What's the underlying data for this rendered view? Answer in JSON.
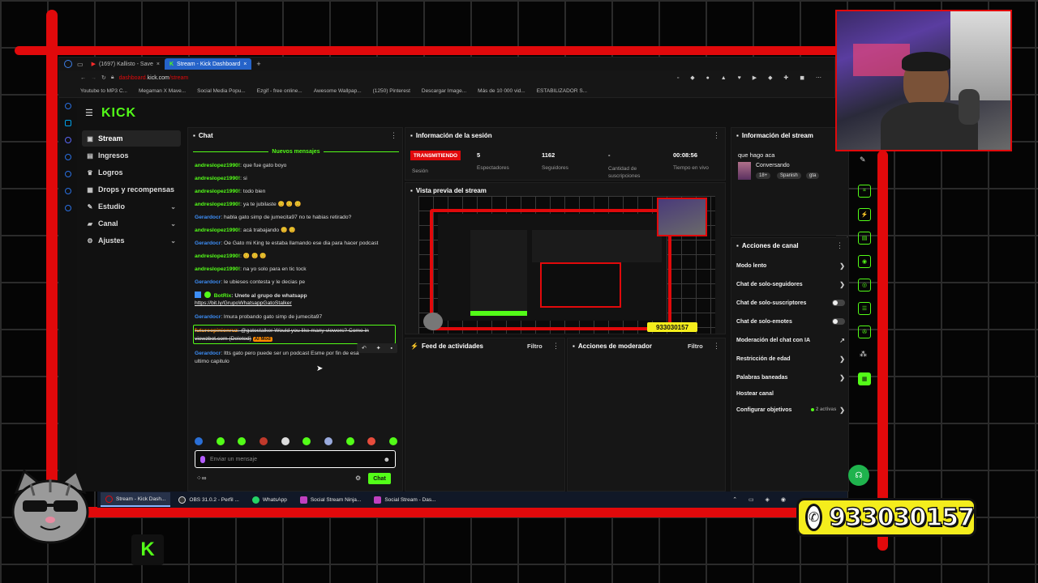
{
  "browser": {
    "tabs": [
      {
        "label": "(1697) Kallisto - Save"
      },
      {
        "label": "Stream - Kick Dashboard"
      }
    ],
    "url_sub": "dashboard.",
    "url_host": "kick.com",
    "url_path": "/stream",
    "bookmarks": [
      "Youtube to MP3 C...",
      "Megaman X Mave...",
      "Social Media Popu...",
      "Ezgif - free online...",
      "Awesome Wallpap...",
      "(1250) Pinterest",
      "Descargar Image...",
      "Más de 10 000 vid...",
      "ESTABILIZADOR S..."
    ]
  },
  "sidebar": {
    "logo": "KICK",
    "items": [
      {
        "label": "Stream",
        "icon": "stream-icon"
      },
      {
        "label": "Ingresos",
        "icon": "revenue-icon"
      },
      {
        "label": "Logros",
        "icon": "trophy-icon"
      },
      {
        "label": "Drops y recompensas",
        "icon": "gift-icon"
      },
      {
        "label": "Estudio",
        "icon": "studio-icon"
      },
      {
        "label": "Canal",
        "icon": "channel-icon"
      },
      {
        "label": "Ajustes",
        "icon": "gear-icon"
      }
    ]
  },
  "chat": {
    "title": "Chat",
    "new_messages": "Nuevos mensajes",
    "messages": [
      {
        "user": "andreslopez1990!",
        "text": ": que fue gato boyo"
      },
      {
        "user": "andreslopez1990!",
        "text": ": si"
      },
      {
        "user": "andreslopez1990!",
        "text": ": todo bien"
      },
      {
        "user": "andreslopez1990!",
        "text": ": ya te jubilaste 😊 😊 😊"
      },
      {
        "user": "Gerardocr",
        "text": ": habla gato simp de jumecita97 no te habias retirado?"
      },
      {
        "user": "andreslopez1990!",
        "text": ": acá trabajando 😊 😊"
      },
      {
        "user": "Gerardocr",
        "text": ": Oe Gato mi King te estaba llamando ese dia para hacer podcast"
      },
      {
        "user": "andreslopez1990!",
        "text": ": 😊 😊 😊"
      },
      {
        "user": "andreslopez1990!",
        "text": ": na yo solo para en tic tock"
      },
      {
        "user": "Gerardocr",
        "text": ": le ubieses contesta y le decias pe"
      },
      {
        "user": "BotRix",
        "text": ": Unete al grupo de whatsapp"
      },
      {
        "user": "",
        "text": "https://bit.ly/GrupoWhatsappGatoStalker"
      },
      {
        "user": "Gerardocr",
        "text": ": lmura probando gato simp de jumecita97"
      },
      {
        "user": "futureopinionruz",
        "text": ": @gatostalker Would you like many viewers? Come in"
      },
      {
        "user": "",
        "text": "viewzbot.com (Deleted)"
      },
      {
        "user": "Gerardocr",
        "text": ": Itts gato pero puede ser un podcast Esme por fin de esa"
      },
      {
        "user": "",
        "text": "ultimo capitulo"
      }
    ],
    "mod_badge": "AI Mod",
    "input_placeholder": "Enviar un mensaje",
    "send_label": "Chat"
  },
  "session": {
    "title": "Información de la sesión",
    "live_badge": "TRANSMITIENDO",
    "session_label": "Sesión",
    "stats": [
      {
        "value": "5",
        "label": "Espectadores"
      },
      {
        "value": "1162",
        "label": "Seguidores"
      },
      {
        "value": "-",
        "label": "Cantidad de suscripciones"
      },
      {
        "value": "00:08:56",
        "label": "Tiempo en vivo"
      }
    ]
  },
  "preview": {
    "title": "Vista previa del stream",
    "phone_overlay": "933030157"
  },
  "activity": {
    "title": "Feed de actividades",
    "filter": "Filtro"
  },
  "moderator": {
    "title": "Acciones de moderador",
    "filter": "Filtro"
  },
  "stream_info": {
    "title": "Información del stream",
    "stream_title": "que hago aca",
    "category": "Conversando",
    "tags": [
      "18+",
      "Spanish",
      "gta"
    ]
  },
  "channel_actions": {
    "title": "Acciones de canal",
    "items": [
      {
        "label": "Modo lento",
        "kind": "chevron"
      },
      {
        "label": "Chat de solo-seguidores",
        "kind": "chevron"
      },
      {
        "label": "Chat de solo-suscriptores",
        "kind": "toggle"
      },
      {
        "label": "Chat de solo-emotes",
        "kind": "toggle"
      },
      {
        "label": "Moderación del chat con IA",
        "kind": "external"
      },
      {
        "label": "Restricción de edad",
        "kind": "chevron"
      },
      {
        "label": "Palabras baneadas",
        "kind": "chevron"
      },
      {
        "label": "Hostear canal",
        "kind": "none"
      },
      {
        "label": "Configurar objetivos",
        "kind": "chevron",
        "extra": "2 activas"
      }
    ]
  },
  "taskbar": {
    "items": [
      "Stream - Kick Dash...",
      "OBS 31.0.2 - Perfil ...",
      "WhatsApp",
      "Social Stream Ninja...",
      "Social Stream - Das..."
    ]
  },
  "overlay": {
    "phone_number": "933030157",
    "logo_letter": "K"
  },
  "colors": {
    "kick_green": "#53fc18",
    "frame_red": "#e1090b",
    "live_red": "#e1090b",
    "phone_yellow": "#f4ed1c"
  }
}
